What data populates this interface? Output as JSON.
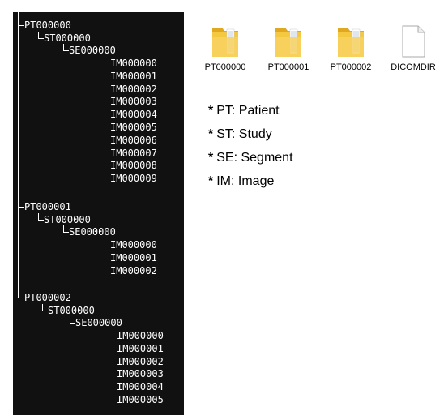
{
  "tree": {
    "groups": [
      {
        "patient": "PT000000",
        "study": "ST000000",
        "segment": "SE000000",
        "images": [
          "IM000000",
          "IM000001",
          "IM000002",
          "IM000003",
          "IM000004",
          "IM000005",
          "IM000006",
          "IM000007",
          "IM000008",
          "IM000009"
        ]
      },
      {
        "patient": "PT000001",
        "study": "ST000000",
        "segment": "SE000000",
        "images": [
          "IM000000",
          "IM000001",
          "IM000002"
        ]
      },
      {
        "patient": "PT000002",
        "study": "ST000000",
        "segment": "SE000000",
        "images": [
          "IM000000",
          "IM000001",
          "IM000002",
          "IM000003",
          "IM000004",
          "IM000005"
        ]
      }
    ]
  },
  "files": [
    {
      "name": "PT000000",
      "icon": "folder-icon"
    },
    {
      "name": "PT000001",
      "icon": "folder-icon"
    },
    {
      "name": "PT000002",
      "icon": "folder-icon"
    },
    {
      "name": "DICOMDIR",
      "icon": "file-icon"
    }
  ],
  "legend": [
    {
      "bullet": "*",
      "text": "PT: Patient"
    },
    {
      "bullet": "*",
      "text": "ST: Study"
    },
    {
      "bullet": "*",
      "text": "SE: Segment"
    },
    {
      "bullet": "*",
      "text": "IM: Image"
    }
  ],
  "colors": {
    "panel_bg": "#111111",
    "panel_text": "#ffffff",
    "folder_yellow": "#f5c842",
    "folder_dark": "#e0a820"
  }
}
